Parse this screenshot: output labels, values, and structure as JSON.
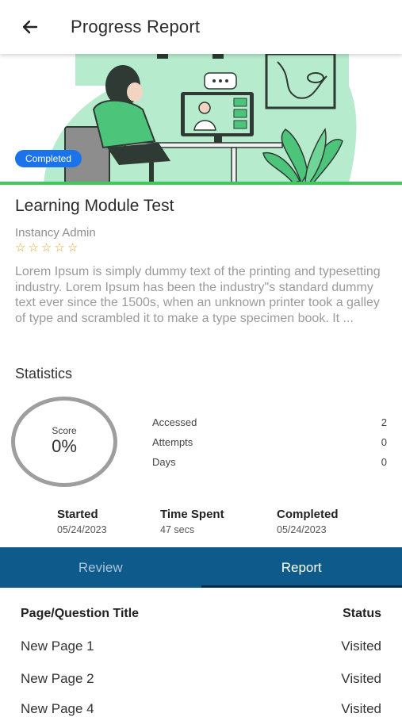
{
  "header": {
    "title": "Progress Report",
    "back_icon": "arrow-left-icon"
  },
  "hero": {
    "badge": "Completed"
  },
  "course": {
    "title": "Learning Module Test",
    "author": "Instancy Admin",
    "rating": 0,
    "rating_max": 5,
    "description": "Lorem Ipsum is simply dummy text of the printing and typesetting industry. Lorem Ipsum has been the industry\"s standard dummy text ever since the 1500s, when an unknown printer took a galley of type and scrambled it to make a type specimen book. It ..."
  },
  "statistics": {
    "heading": "Statistics",
    "score_label": "Score",
    "score_value": "0%",
    "rows": [
      {
        "label": "Accessed",
        "value": "2"
      },
      {
        "label": "Attempts",
        "value": "0"
      },
      {
        "label": "Days",
        "value": "0"
      }
    ],
    "dates": [
      {
        "label": "Started",
        "value": "05/24/2023"
      },
      {
        "label": "Time Spent",
        "value": "47 secs"
      },
      {
        "label": "Completed",
        "value": "05/24/2023"
      }
    ]
  },
  "tabs": [
    {
      "label": "Review",
      "active": false
    },
    {
      "label": "Report",
      "active": true
    }
  ],
  "table": {
    "col_title": "Page/Question Title",
    "col_status": "Status",
    "rows": [
      {
        "title": "New Page 1",
        "status": "Visited"
      },
      {
        "title": "New Page 2",
        "status": "Visited"
      },
      {
        "title": "New Page 4",
        "status": "Visited"
      }
    ]
  },
  "colors": {
    "accent": "#0d5a8b",
    "badge": "#1a73e8",
    "progress": "#3fc95b",
    "star": "#e0a52a"
  }
}
